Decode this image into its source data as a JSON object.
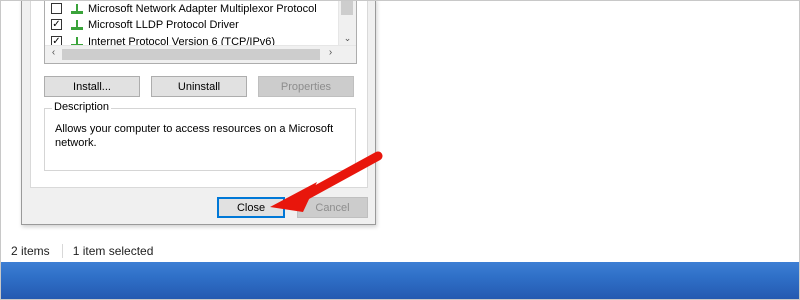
{
  "dialog": {
    "components": [
      {
        "label": "Microsoft Network Adapter Multiplexor Protocol",
        "checked": false
      },
      {
        "label": "Microsoft LLDP Protocol Driver",
        "checked": true
      },
      {
        "label": "Internet Protocol Version 6 (TCP/IPv6)",
        "checked": true
      }
    ],
    "buttons": {
      "install": "Install...",
      "uninstall": "Uninstall",
      "properties": "Properties"
    },
    "description": {
      "title": "Description",
      "text": "Allows your computer to access resources on a Microsoft network."
    },
    "footer": {
      "close": "Close",
      "cancel": "Cancel"
    }
  },
  "statusbar": {
    "item_count": "2 items",
    "selection": "1 item selected"
  },
  "annotation": {
    "icon": "red-arrow-icon",
    "color": "#e8160c"
  },
  "colors": {
    "taskbar": "#2f6fc7",
    "focus_border": "#0078d7",
    "network_icon": "#3aa33a"
  }
}
